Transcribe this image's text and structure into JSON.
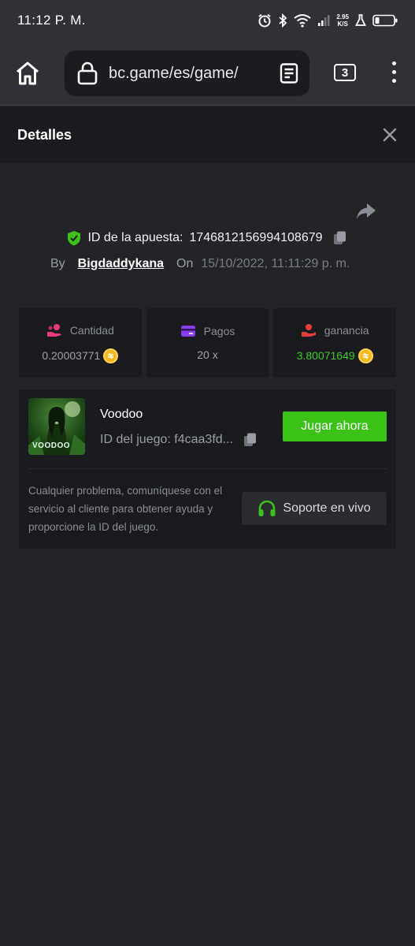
{
  "status_bar": {
    "time": "11:12 P. M.",
    "net_speed_value": "2.95",
    "net_speed_unit": "K/S",
    "icons": [
      "alarm-icon",
      "bluetooth-icon",
      "wifi-icon",
      "signal-icon",
      "flask-icon",
      "battery-icon"
    ]
  },
  "browser": {
    "url": "bc.game/es/game/",
    "tab_count": "3",
    "icons": [
      "home-icon",
      "lock-icon",
      "reader-mode-icon",
      "more-vert-icon"
    ]
  },
  "modal": {
    "title": "Detalles",
    "bet_id_label": "ID de la apuesta:",
    "bet_id_value": "1746812156994108679",
    "by_label": "By",
    "username": "Bigdaddykana",
    "on_label": "On",
    "date": "15/10/2022, 11:11:29 p. m."
  },
  "stats": [
    {
      "label": "Cantidad",
      "value": "0.20003771",
      "icon": "coins-hand-icon",
      "icon_color": "#e8397e",
      "coin": true
    },
    {
      "label": "Pagos",
      "value": "20 x",
      "icon": "card-icon",
      "icon_color": "#8a3cf0",
      "coin": false
    },
    {
      "label": "ganancia",
      "value": "3.80071649",
      "icon": "profit-hand-icon",
      "icon_color": "#e53c3c",
      "coin": true,
      "value_color": "#3fc82a"
    }
  ],
  "game": {
    "name": "Voodoo",
    "thumb_text": "VOODOO",
    "id_label": "ID del juego: f4caa3fd...",
    "play_label": "Jugar ahora",
    "help_text": "Cualquier problema, comuníquese con el servicio al cliente para obtener ayuda y proporcione la ID del juego.",
    "support_label": "Soporte en vivo"
  },
  "colors": {
    "accent_green": "#3bc117",
    "background": "#232428",
    "card": "#1a1b1e",
    "verified_green": "#3bc117"
  }
}
